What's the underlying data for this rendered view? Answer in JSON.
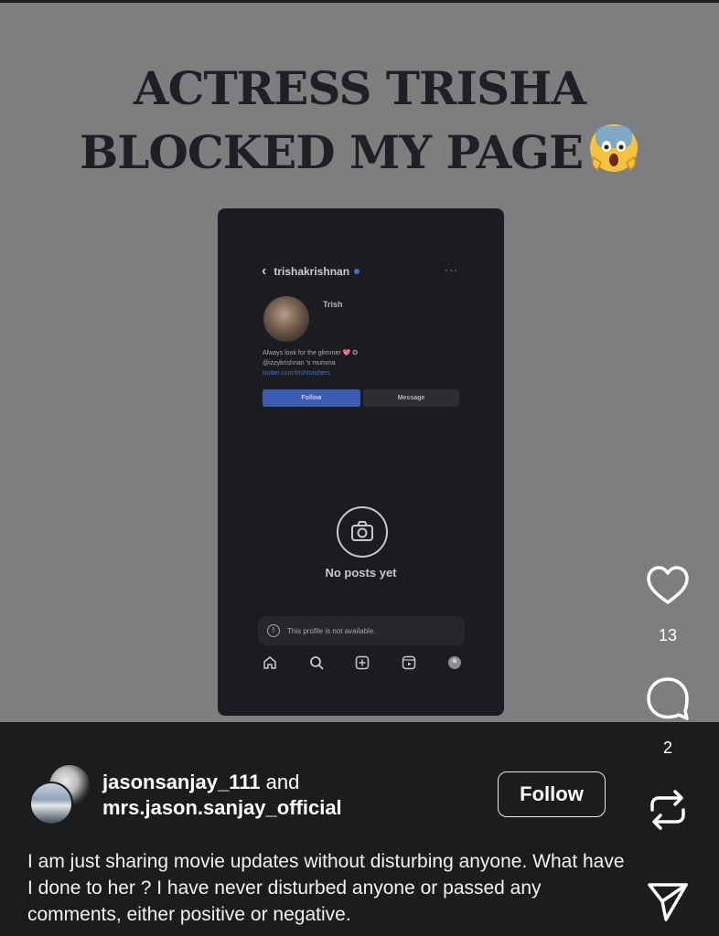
{
  "headline": {
    "line1": "ACTRESS TRISHA",
    "line2": "BLOCKED MY PAGE"
  },
  "embedded_profile": {
    "username": "trishakrishnan",
    "name": "Trish",
    "bio_line1": "Always look for the glimmer 💖 ✪",
    "bio_line2": "@izzykrishnan 's mumma",
    "bio_link": "twitter.com/trishtrashers",
    "follow_label": "Follow",
    "message_label": "Message",
    "no_posts": "No posts yet",
    "notice": "This profile is not available."
  },
  "post": {
    "user1": "jasonsanjay_111",
    "and_text": "and",
    "user2": "mrs.jason.sanjay_official",
    "follow_label": "Follow",
    "caption": "I am just sharing movie updates without disturbing anyone. What have I done to her ? I have never disturbed anyone or passed any comments, either positive or negative."
  },
  "actions": {
    "likes": "13",
    "comments": "2"
  },
  "icons": [
    "back-icon",
    "more-icon",
    "camera-icon",
    "info-icon",
    "home-icon",
    "search-icon",
    "add-icon",
    "reels-icon",
    "profile-icon",
    "heart-icon",
    "comment-icon",
    "repost-icon",
    "share-icon",
    "shocked-emoji"
  ],
  "colors": {
    "background": "#7d7e80",
    "panel": "#1b1c1e",
    "headline": "#1f2023",
    "phone_bg": "#1b1c1f",
    "follow_blue": "#3b5bb5"
  }
}
